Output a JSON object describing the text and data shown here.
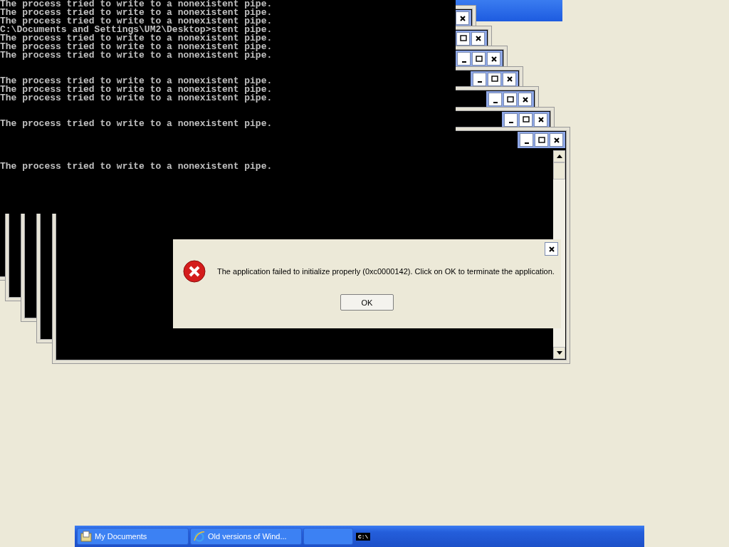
{
  "console": {
    "blocks": [
      {
        "lines": [
          "The process tried to write to a nonexistent pipe.",
          "The process tried to write to a nonexistent pipe.",
          "The process tried to write to a nonexistent pipe.",
          "C:\\Documents and Settings\\UM2\\Desktop>stent pipe.",
          "The process tried to write to a nonexistent pipe.",
          "The process tried to write to a nonexistent pipe.",
          "The process tried to write to a nonexistent pipe."
        ]
      },
      {
        "lines": [
          "The process tried to write to a nonexistent pipe.",
          "The process tried to write to a nonexistent pipe.",
          "The process tried to write to a nonexistent pipe."
        ]
      },
      {
        "lines": [
          "The process tried to write to a nonexistent pipe."
        ]
      },
      {
        "lines": [
          "The process tried to write to a nonexistent pipe."
        ]
      }
    ]
  },
  "dialog": {
    "message": "The application failed to initialize properly (0xc0000142). Click on OK to terminate the application.",
    "ok_button": "OK"
  },
  "taskbar": {
    "items": [
      {
        "kind": "folder",
        "label": "My Documents"
      },
      {
        "kind": "browser",
        "label": "Old versions of Wind..."
      },
      {
        "kind": "blank"
      },
      {
        "kind": "console",
        "label": "C:\\"
      }
    ]
  }
}
